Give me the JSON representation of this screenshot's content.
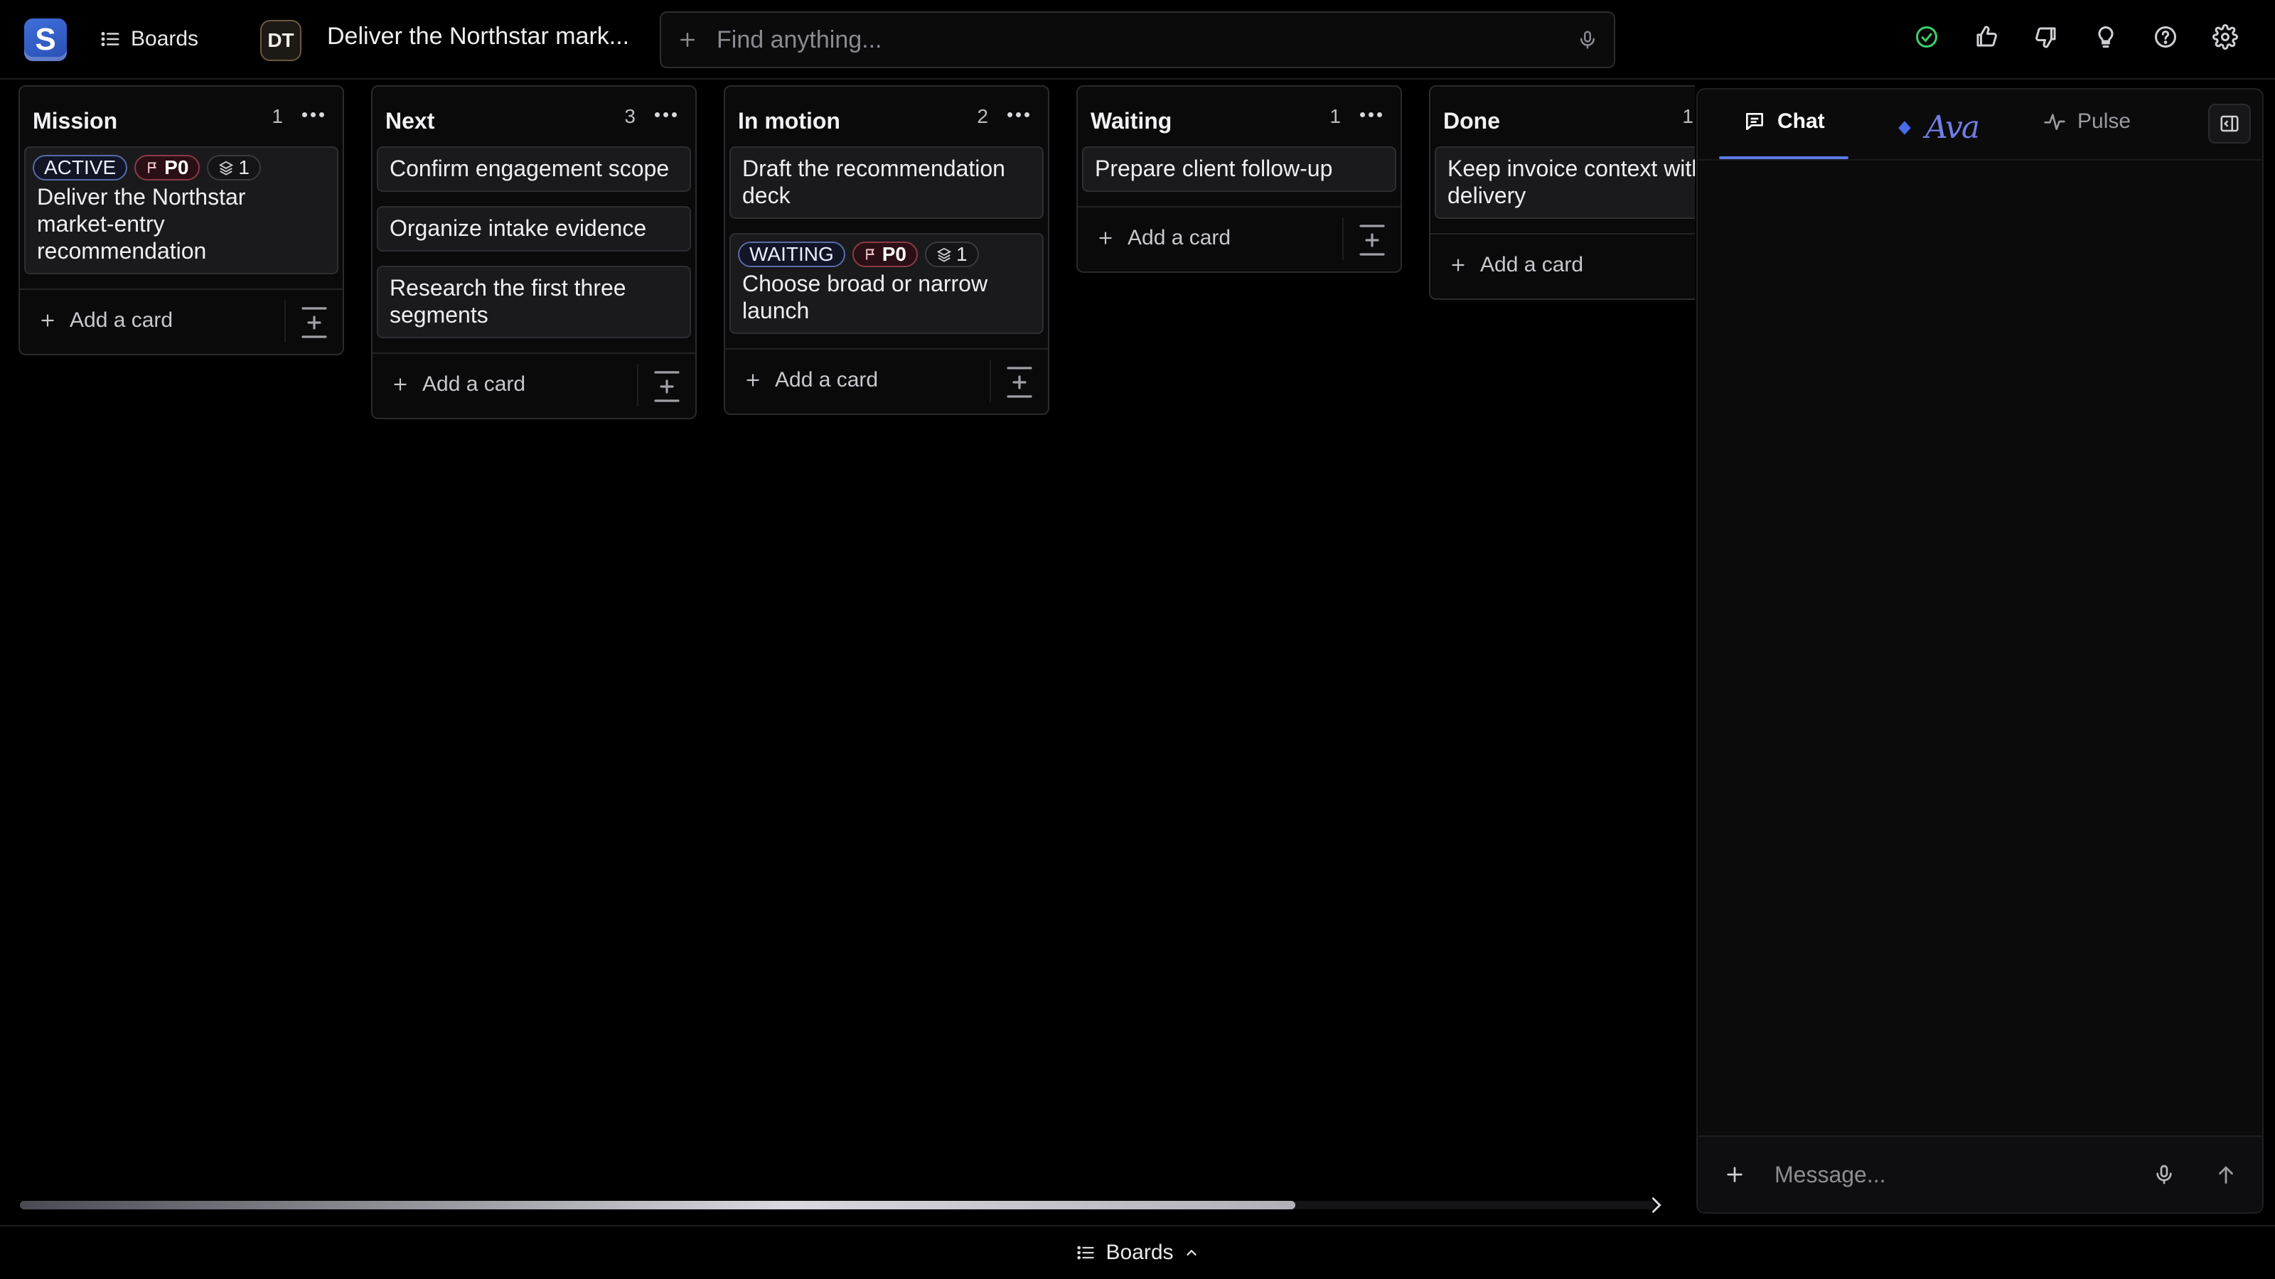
{
  "app": {
    "logo_letter": "S",
    "brand_color": "#3058c4"
  },
  "nav": {
    "boards_label": "Boards"
  },
  "workspace": {
    "avatar_initials": "DT"
  },
  "board": {
    "title": "Deliver the Northstar mark..."
  },
  "search": {
    "placeholder": "Find anything..."
  },
  "top_icons": [
    "check-circle-icon",
    "thumbs-up-icon",
    "thumbs-down-icon",
    "lightbulb-icon",
    "help-icon",
    "settings-icon"
  ],
  "columns": [
    {
      "title": "Mission",
      "count": "1",
      "cards": [
        {
          "badges": {
            "status": "ACTIVE",
            "priority": "P0",
            "subtasks": "1"
          },
          "text": "Deliver the Northstar market-entry recommendation"
        }
      ],
      "add_label": "Add a card"
    },
    {
      "title": "Next",
      "count": "3",
      "cards": [
        {
          "text": "Confirm engagement scope"
        },
        {
          "text": "Organize intake evidence"
        },
        {
          "text": "Research the first three segments"
        }
      ],
      "add_label": "Add a card"
    },
    {
      "title": "In motion",
      "count": "2",
      "cards": [
        {
          "text": "Draft the recommendation deck"
        },
        {
          "badges": {
            "status": "WAITING",
            "priority": "P0",
            "subtasks": "1"
          },
          "text": "Choose broad or narrow launch"
        }
      ],
      "add_label": "Add a card"
    },
    {
      "title": "Waiting",
      "count": "1",
      "cards": [
        {
          "text": "Prepare client follow-up"
        }
      ],
      "add_label": "Add a card"
    },
    {
      "title": "Done",
      "count": "1",
      "cards": [
        {
          "text": "Keep invoice context with delivery"
        }
      ],
      "add_label": "Add a card"
    }
  ],
  "scrollbar": {
    "position_fraction": 0.0,
    "visible_fraction": 0.78
  },
  "bottom_bar": {
    "label": "Boards"
  },
  "panel": {
    "tabs": {
      "chat": "Chat",
      "ava": "Ava",
      "pulse": "Pulse"
    },
    "active_tab": "Chat",
    "composer_placeholder": "Message..."
  }
}
